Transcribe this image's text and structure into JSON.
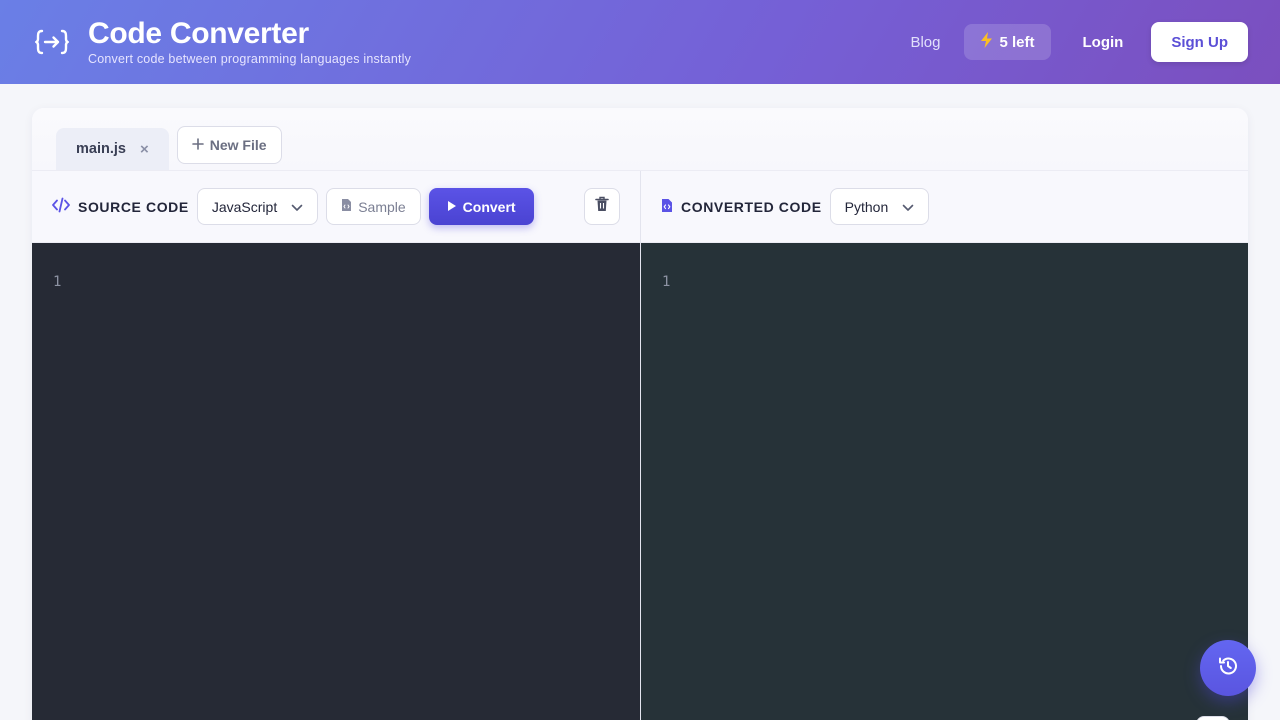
{
  "header": {
    "title": "Code Converter",
    "subtitle": "Convert code between programming languages instantly",
    "logo_icon": "code-arrow-brackets-icon",
    "nav": {
      "blog": "Blog",
      "credits": "5 left",
      "credits_icon": "lightning-icon",
      "login": "Login",
      "signup": "Sign Up"
    }
  },
  "tabs": {
    "items": [
      {
        "label": "main.js",
        "close": "×"
      }
    ],
    "new_file": "New File"
  },
  "source": {
    "title": "SOURCE CODE",
    "language": "JavaScript",
    "sample_label": "Sample",
    "convert_label": "Convert",
    "line_numbers": [
      "1"
    ]
  },
  "converted": {
    "title": "CONVERTED CODE",
    "language": "Python",
    "line_numbers": [
      "1"
    ]
  },
  "colors": {
    "accent": "#5b53e6",
    "editor_bg_source": "#262a35",
    "editor_bg_target": "#263238"
  }
}
